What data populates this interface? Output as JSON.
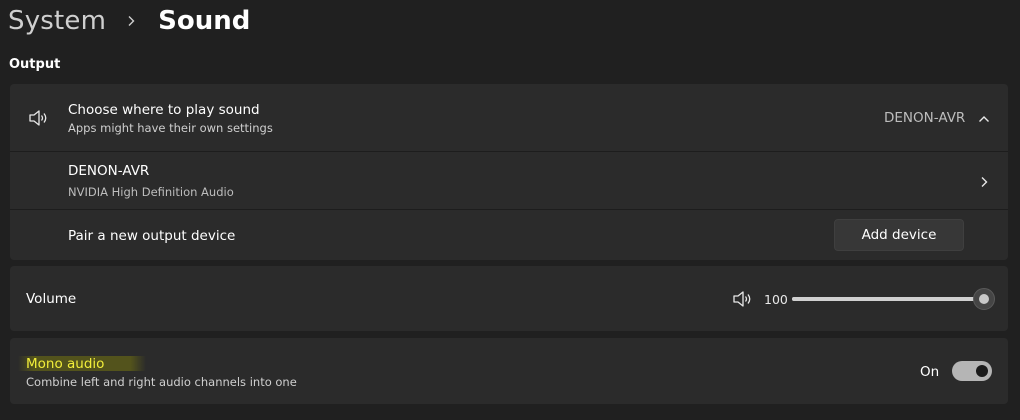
{
  "breadcrumb": {
    "parent": "System",
    "current": "Sound"
  },
  "section": {
    "title": "Output"
  },
  "output_choice": {
    "title": "Choose where to play sound",
    "subtitle": "Apps might have their own settings",
    "selected": "DENON-AVR",
    "icon": "speaker-icon",
    "expander_icon": "chevron-up-icon"
  },
  "device": {
    "name": "DENON-AVR",
    "driver": "NVIDIA High Definition Audio",
    "icon": "chevron-right-icon"
  },
  "pair": {
    "label": "Pair a new output device",
    "button": "Add device"
  },
  "volume": {
    "label": "Volume",
    "value": "100",
    "level": 1.0,
    "icon": "speaker-icon"
  },
  "mono": {
    "title": "Mono audio",
    "subtitle": "Combine left and right audio channels into one",
    "state": "On",
    "highlight_color": "#5a5a19"
  },
  "colors": {
    "background": "#202020",
    "card": "#2b2b2b",
    "text": "#ffffff"
  }
}
